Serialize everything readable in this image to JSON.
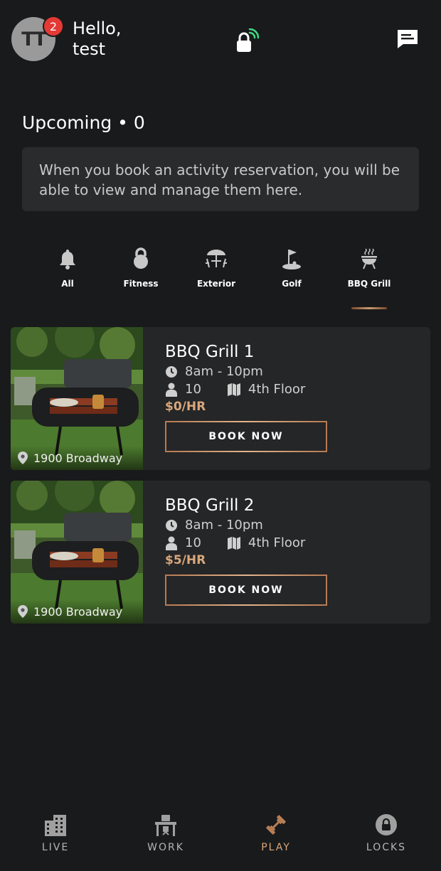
{
  "header": {
    "avatar_initials": "TT",
    "notification_count": "2",
    "greeting_line1": "Hello,",
    "greeting_line2": "test",
    "lock_icon": "smart-lock-icon",
    "chat_icon": "chat-icon"
  },
  "upcoming": {
    "title": "Upcoming • 0",
    "empty_message": "When you book an activity reservation, you will be able to view and manage them here."
  },
  "categories": [
    {
      "label": "All",
      "icon": "bell-icon"
    },
    {
      "label": "Fitness",
      "icon": "kettlebell-icon"
    },
    {
      "label": "Exterior",
      "icon": "patio-icon"
    },
    {
      "label": "Golf",
      "icon": "golf-icon"
    },
    {
      "label": "BBQ Grill",
      "icon": "bbq-grill-icon",
      "selected": true
    }
  ],
  "listings": [
    {
      "title": "BBQ Grill 1",
      "hours": "8am - 10pm",
      "capacity": "10",
      "floor": "4th Floor",
      "price": "$0/HR",
      "location": "1900 Broadway",
      "button": "BOOK NOW"
    },
    {
      "title": "BBQ Grill 2",
      "hours": "8am - 10pm",
      "capacity": "10",
      "floor": "4th Floor",
      "price": "$5/HR",
      "location": "1900 Broadway",
      "button": "BOOK NOW"
    }
  ],
  "bottom_nav": [
    {
      "label": "LIVE",
      "icon": "building-icon"
    },
    {
      "label": "WORK",
      "icon": "desk-icon"
    },
    {
      "label": "PLAY",
      "icon": "dumbbell-icon",
      "active": true
    },
    {
      "label": "LOCKS",
      "icon": "lock-icon"
    }
  ],
  "colors": {
    "background": "#191a1b",
    "card": "#252627",
    "accent": "#d9a77c",
    "badge": "#e53935",
    "wifi": "#3ddc84"
  }
}
